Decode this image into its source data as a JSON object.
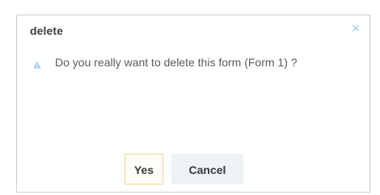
{
  "dialog": {
    "title": "delete",
    "close_icon": "close-icon",
    "message": "Do you really want to delete this form (Form 1) ?",
    "message_icon": "warning-icon",
    "buttons": {
      "yes_label": "Yes",
      "cancel_label": "Cancel"
    }
  },
  "colors": {
    "close_icon": "#a8d3ee",
    "warning_icon": "#9fcfee",
    "yes_border": "#f2d48c",
    "cancel_background": "#eef3f6",
    "dialog_border": "#c9cdd1"
  }
}
